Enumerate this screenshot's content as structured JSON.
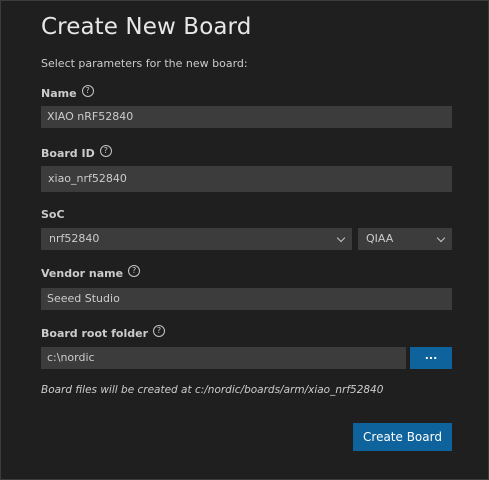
{
  "dialog": {
    "title": "Create New Board",
    "subtitle": "Select parameters for the new board:"
  },
  "fields": {
    "name": {
      "label": "Name",
      "value": "XIAO nRF52840"
    },
    "board_id": {
      "label": "Board ID",
      "value": "xiao_nrf52840"
    },
    "soc": {
      "label": "SoC",
      "value": "nrf52840",
      "variant": "QIAA"
    },
    "vendor": {
      "label": "Vendor name",
      "value": "Seeed Studio"
    },
    "root_folder": {
      "label": "Board root folder",
      "value": "c:\\nordic",
      "browse_label": "..."
    }
  },
  "help_glyph": "?",
  "note": "Board files will be created at c:/nordic/boards/arm/xiao_nrf52840",
  "actions": {
    "create_label": "Create Board"
  },
  "colors": {
    "background": "#1f1f1f",
    "input": "#3c3c3c",
    "accent": "#0e639c"
  }
}
